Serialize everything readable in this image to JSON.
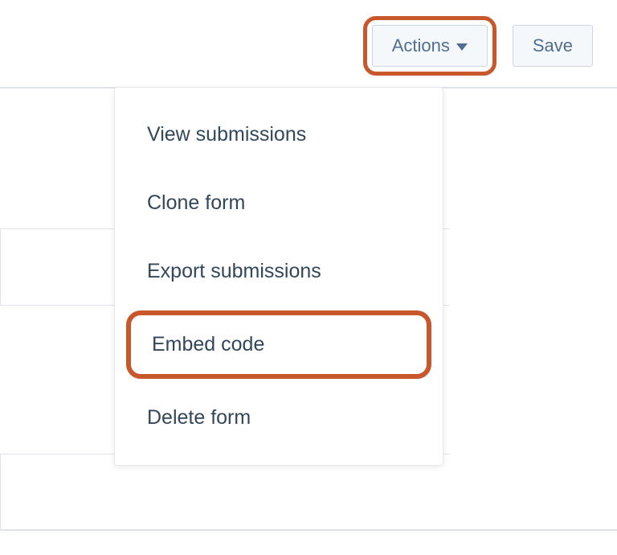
{
  "toolbar": {
    "actions_label": "Actions",
    "save_label": "Save"
  },
  "dropdown": {
    "items": [
      {
        "label": "View submissions"
      },
      {
        "label": "Clone form"
      },
      {
        "label": "Export submissions"
      },
      {
        "label": "Embed code"
      },
      {
        "label": "Delete form"
      }
    ]
  }
}
